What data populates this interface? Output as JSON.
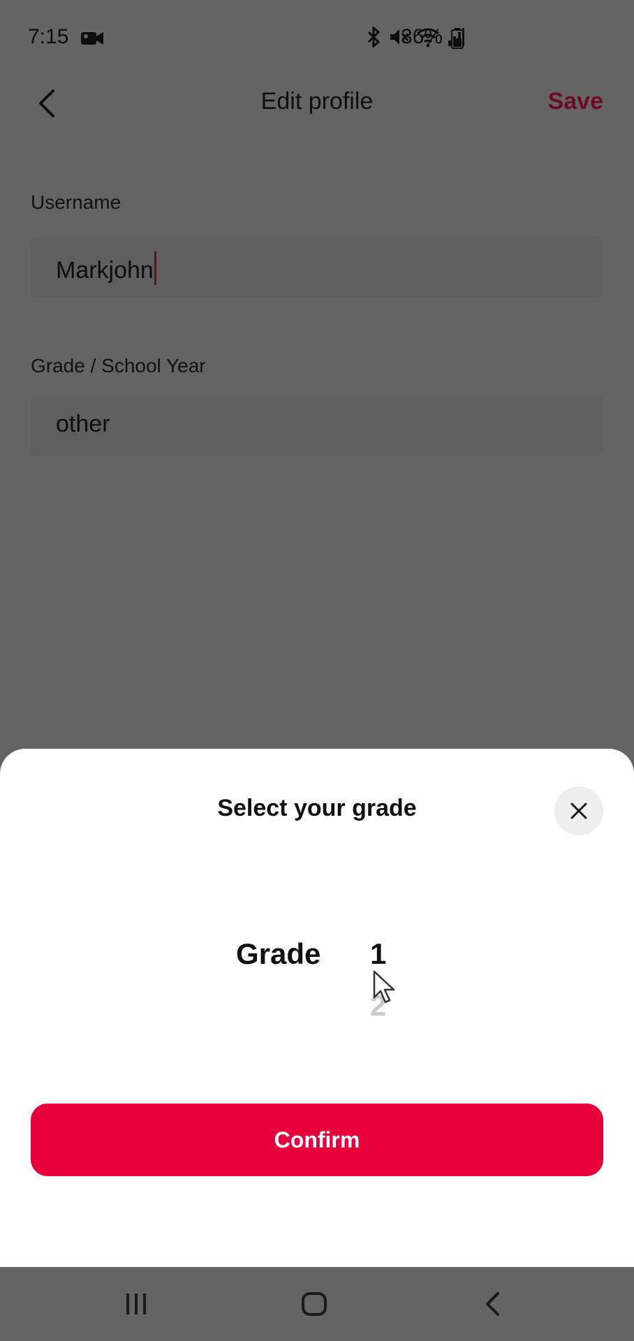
{
  "status_bar": {
    "time": "7:15",
    "battery_percent": "36%",
    "icons": [
      "video-camera-icon",
      "bluetooth-icon",
      "mute-icon",
      "wifi-icon",
      "signal-icon",
      "battery-icon"
    ]
  },
  "header": {
    "title": "Edit profile",
    "save_label": "Save",
    "back_icon": "chevron-left-icon"
  },
  "form": {
    "username": {
      "label": "Username",
      "value": "Markjohn"
    },
    "grade": {
      "label": "Grade / School Year",
      "value": "other"
    }
  },
  "sheet": {
    "title": "Select your grade",
    "close_icon": "close-icon",
    "picker": {
      "label": "Grade",
      "selected": "1",
      "next": "2"
    },
    "confirm_label": "Confirm"
  },
  "colors": {
    "accent": "#e8003c",
    "save_text": "#6f0a22",
    "dim_overlay": "#646464",
    "sheet_bg": "#ffffff"
  },
  "nav_bar": {
    "icons": [
      "recent-apps-icon",
      "home-icon",
      "back-icon"
    ]
  }
}
